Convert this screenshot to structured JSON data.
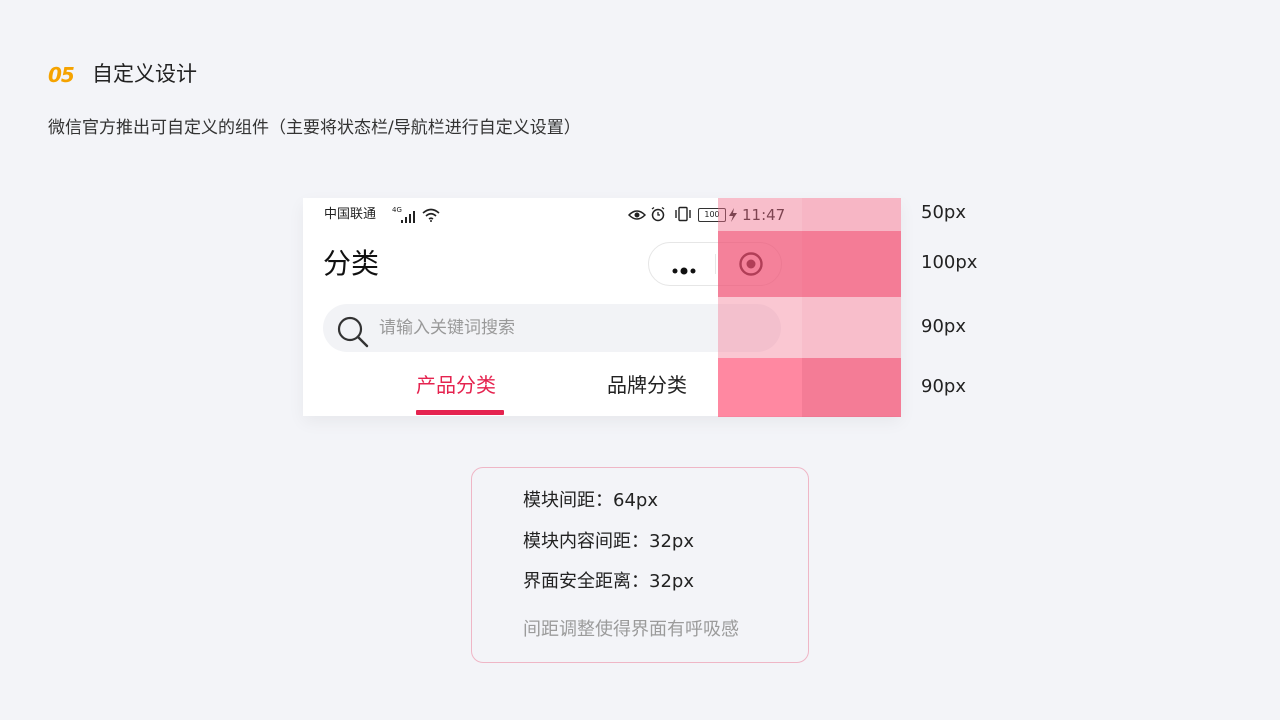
{
  "header": {
    "section_number": "05",
    "section_title": "自定义设计",
    "intro": "微信官方推出可自定义的组件（主要将状态栏/导航栏进行自定义设置）"
  },
  "phone": {
    "status_bar": {
      "carrier": "中国联通",
      "network": "4G",
      "battery": "100",
      "time": "11:47",
      "icons": [
        "signal-icon",
        "wifi-icon",
        "eye-icon",
        "alarm-icon",
        "vibrate-icon",
        "charge-icon"
      ]
    },
    "nav": {
      "title": "分类",
      "capsule_icons": [
        "more-icon",
        "target-icon"
      ]
    },
    "search": {
      "placeholder": "请输入关键词搜索"
    },
    "tabs": [
      {
        "label": "产品分类",
        "active": true
      },
      {
        "label": "品牌分类",
        "active": false
      }
    ],
    "colors": {
      "accent": "#e5234f",
      "overlay": "#f0506f"
    }
  },
  "measurements": [
    "50px",
    "100px",
    "90px",
    "90px"
  ],
  "info": {
    "lines": [
      "模块间距：64px",
      "模块内容间距：32px",
      "界面安全距离：32px"
    ],
    "footer": "间距调整使得界面有呼吸感"
  }
}
